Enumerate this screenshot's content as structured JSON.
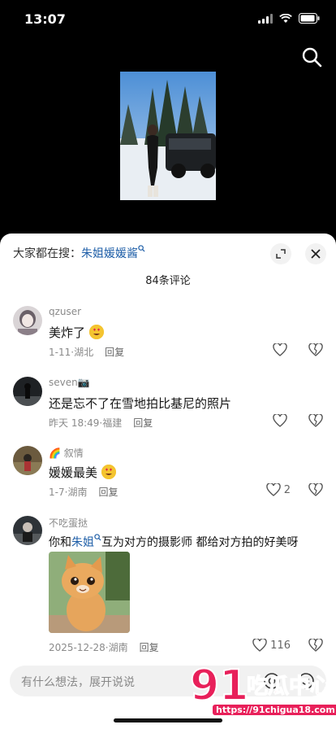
{
  "status": {
    "time": "13:07"
  },
  "trend": {
    "prefix": "大家都在搜：",
    "term": "朱姐媛媛酱"
  },
  "comment_count": "84条评论",
  "comments": [
    {
      "user": "qzuser",
      "text": "美炸了",
      "date": "1-11",
      "location": "湖北",
      "reply": "回复",
      "likes": ""
    },
    {
      "user": "seven📷",
      "text": "还是忘不了在雪地拍比基尼的照片",
      "date": "昨天 18:49",
      "location": "福建",
      "reply": "回复",
      "likes": ""
    },
    {
      "user": "🌈 叙情",
      "text": "媛媛最美",
      "date": "1-7",
      "location": "湖南",
      "reply": "回复",
      "likes": "2"
    },
    {
      "user": "不吃蛋挞",
      "text_before": "你和",
      "mention": "朱姐",
      "text_after": "互为对方的摄影师 都给对方拍的好美呀",
      "date": "2025-12-28",
      "location": "湖南",
      "reply": "回复",
      "likes": "116"
    }
  ],
  "input": {
    "placeholder": "有什么想法，展开说说"
  },
  "watermark": {
    "url": "https://91chigua18.com"
  },
  "colors": {
    "accent": "#1f5fa8",
    "sheet": "#ffffff",
    "watermark": "#e8205a"
  }
}
